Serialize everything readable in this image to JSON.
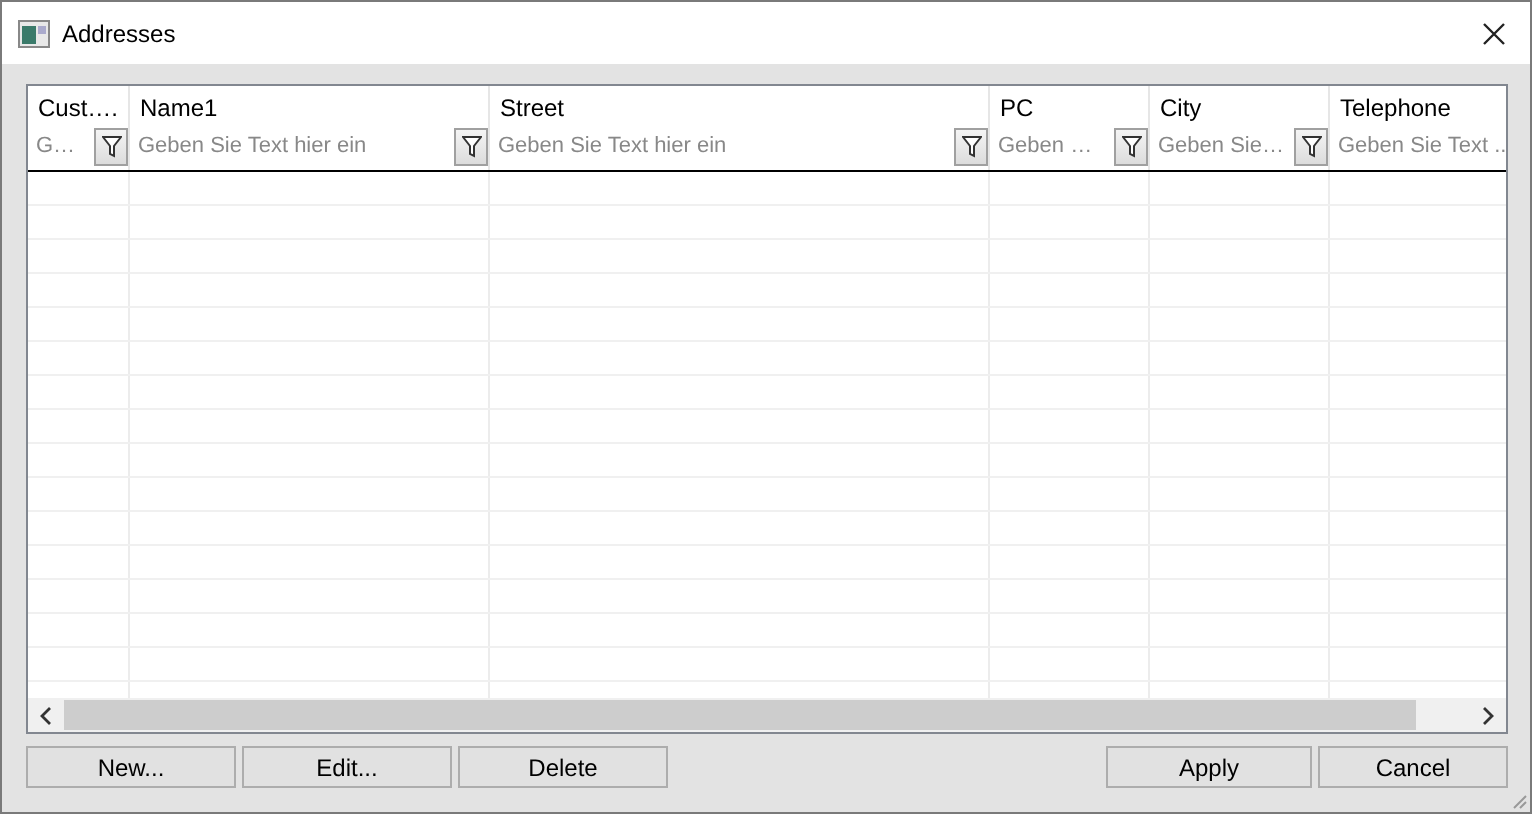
{
  "window": {
    "title": "Addresses"
  },
  "table": {
    "columns": [
      {
        "label": "Cust….",
        "filter_placeholder": "G…"
      },
      {
        "label": "Name1",
        "filter_placeholder": "Geben Sie Text hier ein"
      },
      {
        "label": "Street",
        "filter_placeholder": "Geben Sie Text hier ein"
      },
      {
        "label": "PC",
        "filter_placeholder": "Geben …"
      },
      {
        "label": "City",
        "filter_placeholder": "Geben Sie…"
      },
      {
        "label": "Telephone",
        "filter_placeholder": "Geben Sie Text .."
      }
    ]
  },
  "buttons_left": [
    "New...",
    "Edit...",
    "Delete"
  ],
  "buttons_right": [
    "Apply",
    "Cancel"
  ]
}
